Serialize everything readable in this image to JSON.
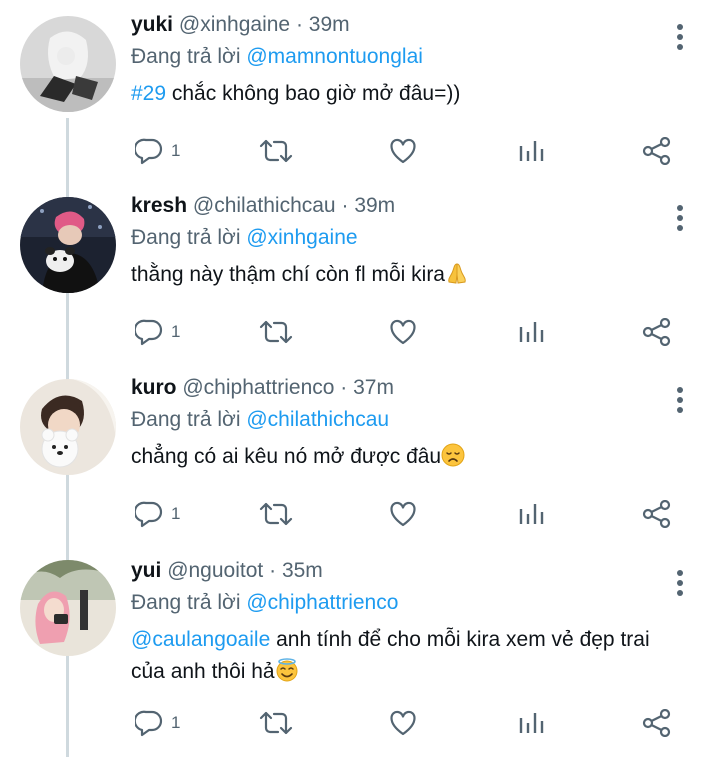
{
  "tweets": [
    {
      "name": "yuki",
      "handle": "@xinhgaine",
      "time": "39m",
      "reply_prefix": "Đang trả lời",
      "reply_to": "@mamnontuonglai",
      "text_tag": "#29",
      "text": " chắc không bao giờ mở đâu=))",
      "reply_count": "1"
    },
    {
      "name": "kresh",
      "handle": "@chilathichcau",
      "time": "39m",
      "reply_prefix": "Đang trả lời",
      "reply_to": "@xinhgaine",
      "text": " thằng này thậm chí còn fl mỗi kira",
      "emoji": "folded-hands-emoji",
      "reply_count": "1"
    },
    {
      "name": "kuro",
      "handle": "@chiphattrienco",
      "time": "37m",
      "reply_prefix": "Đang trả lời",
      "reply_to": "@chilathichcau",
      "text": "chẳng có ai kêu nó mở được đâu",
      "emoji": "disappointed-face-emoji",
      "reply_count": "1"
    },
    {
      "name": "yui",
      "handle": "@nguoitot",
      "time": "35m",
      "reply_prefix": "Đang trả lời",
      "reply_to": "@chiphattrienco",
      "text_mention": "@caulangoaile",
      "text": " anh tính để cho mỗi kira xem vẻ đẹp trai của anh thôi hả",
      "emoji": "smiling-face-with-halo-emoji",
      "reply_count": "1"
    }
  ],
  "separator": "·",
  "colors": {
    "link": "#1d9bf0",
    "secondary_text": "#536471",
    "thread_line": "#cfd9de",
    "icon": "#536471"
  }
}
